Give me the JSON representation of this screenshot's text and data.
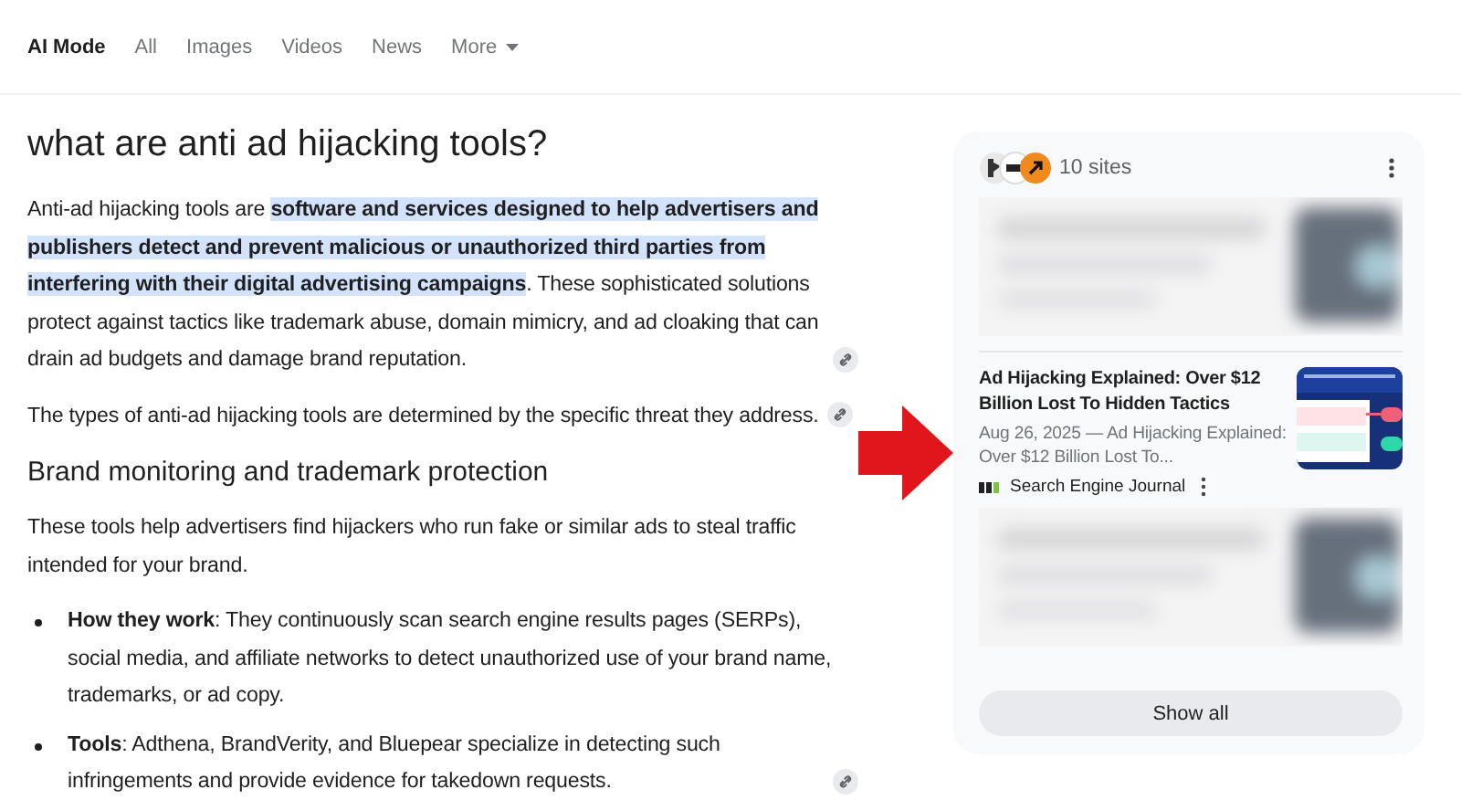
{
  "tabs": [
    {
      "label": "AI Mode",
      "selected": true,
      "dropdown": false
    },
    {
      "label": "All",
      "selected": false,
      "dropdown": false
    },
    {
      "label": "Images",
      "selected": false,
      "dropdown": false
    },
    {
      "label": "Videos",
      "selected": false,
      "dropdown": false
    },
    {
      "label": "News",
      "selected": false,
      "dropdown": false
    },
    {
      "label": "More",
      "selected": false,
      "dropdown": true
    }
  ],
  "answer": {
    "question": "what are anti ad hijacking tools?",
    "blocks": [
      {
        "kind": "paragraph",
        "text": "Anti-ad hijacking tools are **software and services designed to help advertisers and publishers detect and prevent malicious or unauthorized third parties from interfering with their digital advertising campaigns**. These sophisticated solutions protect against tactics like trademark abuse, domain mimicry, and ad cloaking that can drain ad budgets and damage brand reputation.",
        "cited": true
      },
      {
        "kind": "paragraph",
        "text": "The types of anti-ad hijacking tools are determined by the specific threat they address.",
        "cited": true
      },
      {
        "kind": "heading",
        "text": "Brand monitoring and trademark protection",
        "cited": false
      },
      {
        "kind": "paragraph",
        "text": "These tools help advertisers find hijackers who run fake or similar ads to steal traffic intended for your brand.",
        "cited": false
      },
      {
        "kind": "bullet",
        "text": "**How they work**: They continuously scan search engine results pages (SERPs), social media, and affiliate networks to detect unauthorized use of your brand name, trademarks, or ad copy.",
        "cited": false
      },
      {
        "kind": "bullet",
        "text": "**Tools**: Adthena, BrandVerity, and Bluepear specialize in detecting such infringements and provide evidence for takedown requests.",
        "cited": true
      }
    ]
  },
  "sources": {
    "count_label": "10 sites",
    "items": [
      {
        "kind": "blurred"
      },
      {
        "kind": "article",
        "title": "Ad Hijacking Explained: Over $12 Billion Lost To Hidden Tactics",
        "snippet": "Aug 26, 2025 — Ad Hijacking Explained: Over $12 Billion Lost To...",
        "source": "Search Engine Journal"
      },
      {
        "kind": "blurred"
      }
    ],
    "button": "Show all"
  }
}
